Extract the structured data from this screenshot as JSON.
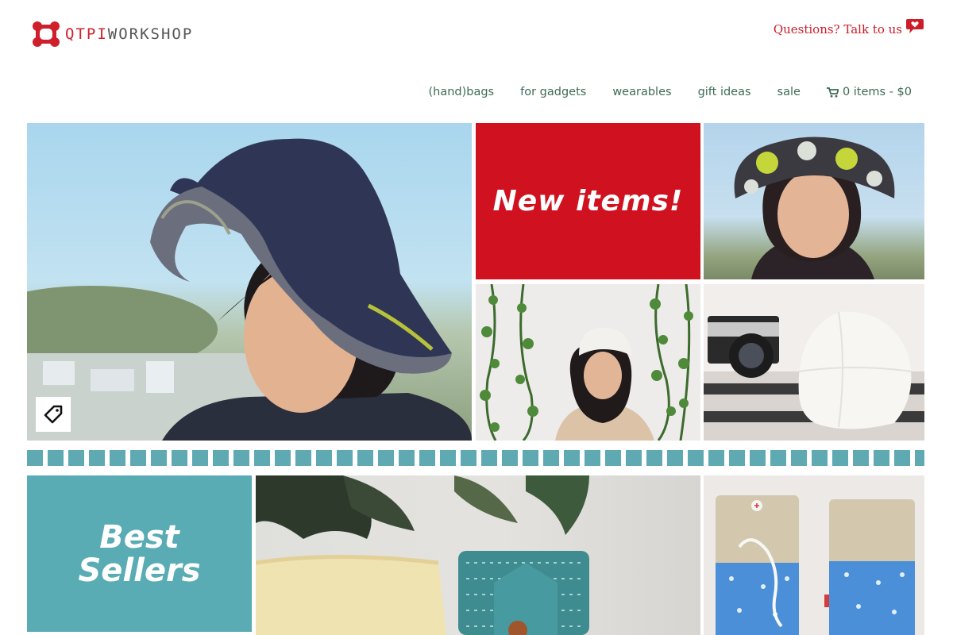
{
  "brand": {
    "name_accent": "QTPI",
    "name_rest": "WORKSHOP",
    "color": "#cf1f2c"
  },
  "contact": {
    "label": "Questions? Talk to us",
    "icon": "speech-heart-icon"
  },
  "nav": {
    "items": [
      {
        "label": "(hand)bags"
      },
      {
        "label": "for gadgets"
      },
      {
        "label": "wearables"
      },
      {
        "label": "gift ideas"
      },
      {
        "label": "sale"
      }
    ],
    "cart": {
      "label": "0 items - $0",
      "icon": "cart-icon"
    }
  },
  "promos": {
    "new_items": {
      "label": "New items!",
      "color": "#d0111f"
    },
    "best_sellers": {
      "line1": "Best",
      "line2": "Sellers",
      "color": "#59abb4"
    }
  },
  "tiles": {
    "hero": {
      "subject": "woman wearing navy reversible bucket hat"
    },
    "patterned_hat": {
      "subject": "woman in patterned bucket hat"
    },
    "ivy_wall": {
      "subject": "woman in white hat against ivy wall"
    },
    "camera_hat": {
      "subject": "white hat beside vintage camera"
    },
    "plant_pouch": {
      "subject": "teal patterned pouch next to plant"
    },
    "phone_sleeves": {
      "subject": "anchor print phone sleeves with earbuds"
    }
  },
  "icons": {
    "tag": "tag-icon"
  },
  "colors": {
    "brand_red": "#cc1d29",
    "nav_green": "#3d6b55",
    "teal": "#5fa9b3"
  }
}
